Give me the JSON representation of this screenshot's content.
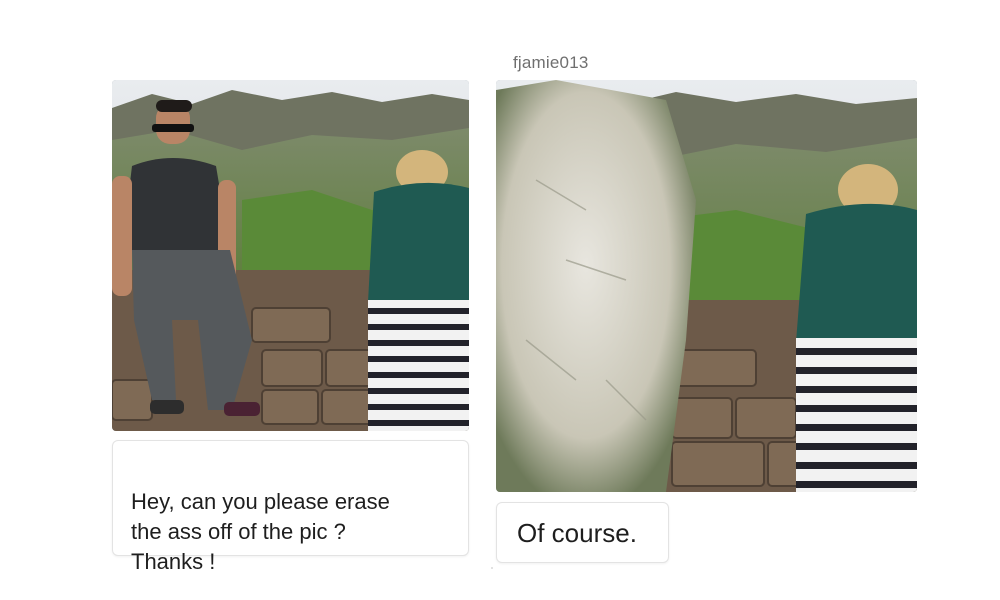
{
  "left_post": {
    "message": "Hey, can you please erase\nthe ass off of the pic ?\nThanks !",
    "photo_alt": "photo"
  },
  "right_post": {
    "username": "fjamie013",
    "reply": "Of course.",
    "photo_alt": "photo"
  },
  "colors": {
    "bubble_border": "#e3e3e3",
    "text": "#1e1e1e",
    "username": "#6f6f6f"
  }
}
